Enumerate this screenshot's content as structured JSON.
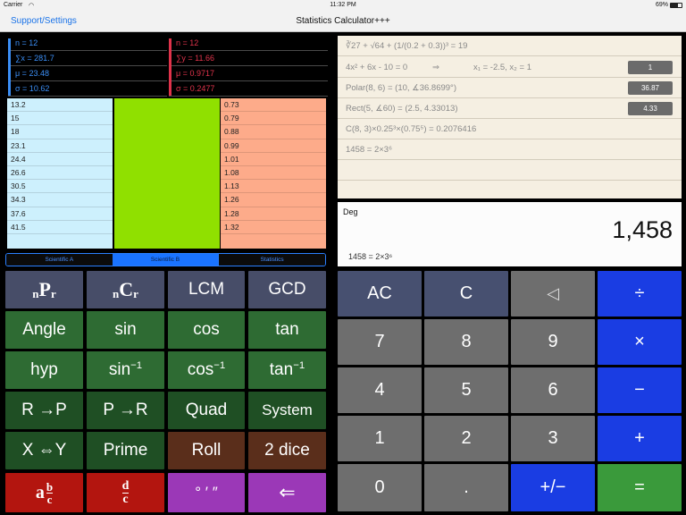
{
  "status": {
    "carrier": "Carrier",
    "time": "11:32 PM",
    "battery": "69%"
  },
  "nav": {
    "left": "Support/Settings",
    "title": "Statistics Calculator+++"
  },
  "stats_x": [
    "n = 12",
    "∑x = 281.7",
    "μ = 23.48",
    "σ = 10.62"
  ],
  "stats_y": [
    "n = 12",
    "∑y = 11.66",
    "μ = 0.9717",
    "σ = 0.2477"
  ],
  "x_values": [
    "13.2",
    "15",
    "18",
    "23.1",
    "24.4",
    "26.6",
    "30.5",
    "34.3",
    "37.6",
    "41.5"
  ],
  "y_values": [
    "0.73",
    "0.79",
    "0.88",
    "0.99",
    "1.01",
    "1.08",
    "1.13",
    "1.26",
    "1.28",
    "1.32"
  ],
  "tabs": [
    "Scientific A",
    "Scientific B",
    "Statistics"
  ],
  "active_tab": "Scientific B",
  "sci_keys": {
    "lcm": "LCM",
    "gcd": "GCD",
    "angle": "Angle",
    "sin": "sin",
    "cos": "cos",
    "tan": "tan",
    "hyp": "hyp",
    "asin": "sin",
    "acos": "cos",
    "atan": "tan",
    "inv": "−1",
    "r_to_p": "R →P",
    "p_to_r": "P →R",
    "quad": "Quad",
    "system": "System",
    "swap": "X ⇔Y",
    "prime": "Prime",
    "roll": "Roll",
    "dice": "2 dice",
    "dms": "° ′ ″",
    "backspace": "⇐"
  },
  "num_keys": {
    "ac": "AC",
    "c": "C",
    "del": "◁",
    "div": "÷",
    "seven": "7",
    "eight": "8",
    "nine": "9",
    "mul": "×",
    "four": "4",
    "five": "5",
    "six": "6",
    "minus": "−",
    "one": "1",
    "two": "2",
    "three": "3",
    "plus": "+",
    "zero": "0",
    "dot": ".",
    "sign": "+/−",
    "eq": "="
  },
  "history": {
    "row1": "∛27 + √64 + (1/(0.2 + 0.3))³ = 19",
    "row2_eq": "4x² + 6x - 10 = 0",
    "row2_arrow": "⇒",
    "row2_sol": "x₁ = -2.5, x₂ = 1",
    "row2_btn": "1",
    "row3": "Polar(8, 6) = (10, ∡36.8699°)",
    "row3_btn": "36.87",
    "row4": "Rect(5, ∡60) = (2.5, 4.33013)",
    "row4_btn": "4.33",
    "row5": "C(8, 3)×0.25³×(0.75⁵) = 0.2076416",
    "row6": "1458 = 2×3⁶"
  },
  "display": {
    "mode": "Deg",
    "value": "1,458",
    "expression": "1458 = 2×3⁶"
  },
  "colors": {
    "stat_x": "#3b8ef5",
    "stat_y": "#e0334b",
    "x_col": "#cdf0fd",
    "empty_col": "#90e000",
    "y_col": "#fdab8a"
  }
}
